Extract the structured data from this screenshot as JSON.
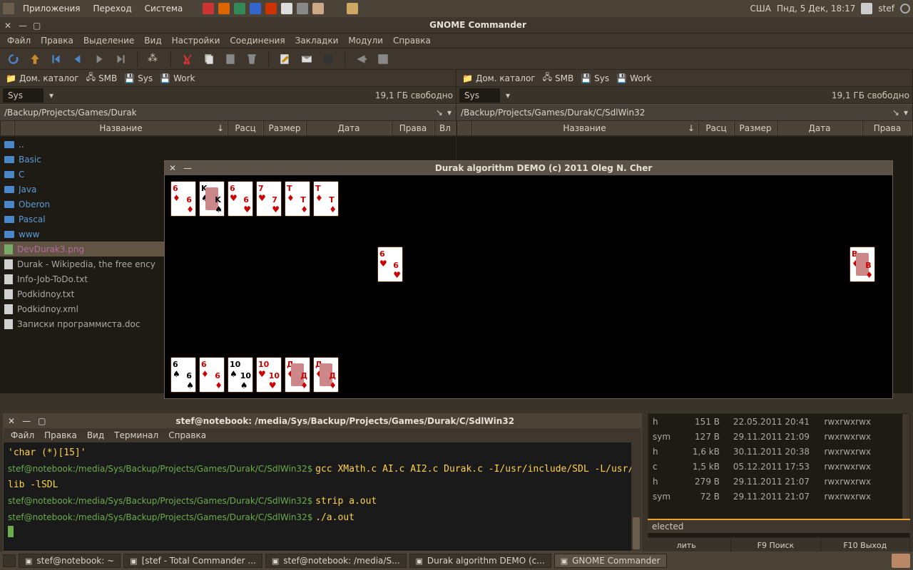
{
  "gnome_panel": {
    "app_menu": "Приложения",
    "places_menu": "Переход",
    "system_menu": "Система",
    "kbd_layout": "США",
    "clock": "Пнд,  5 Дек, 18:17",
    "user": "stef"
  },
  "gcmd": {
    "title": "GNOME Commander",
    "menu": [
      "Файл",
      "Правка",
      "Выделение",
      "Вид",
      "Настройки",
      "Соединения",
      "Закладки",
      "Модули",
      "Справка"
    ],
    "drives": [
      {
        "label": "Дом. каталог",
        "icon": "home-icon"
      },
      {
        "label": "SMB",
        "icon": "smb-icon"
      },
      {
        "label": "Sys",
        "icon": "disk-icon"
      },
      {
        "label": "Work",
        "icon": "disk-icon"
      }
    ],
    "left": {
      "volume": "Sys",
      "free": "19,1 ГБ свободно",
      "path": "/Backup/Projects/Games/Durak",
      "cols": [
        "Название",
        "Расц",
        "Размер",
        "Дата",
        "Права",
        "Вл"
      ],
      "rows": [
        {
          "name": "..",
          "cls": "fn-gray",
          "icon": "fldr"
        },
        {
          "name": "Basic",
          "cls": "fn-blue",
          "icon": "fldr"
        },
        {
          "name": "C",
          "cls": "fn-blue",
          "icon": "fldr"
        },
        {
          "name": "Java",
          "cls": "fn-blue",
          "icon": "fldr"
        },
        {
          "name": "Oberon",
          "cls": "fn-blue",
          "icon": "fldr"
        },
        {
          "name": "Pascal",
          "cls": "fn-blue",
          "icon": "fldr"
        },
        {
          "name": "www",
          "cls": "fn-blue",
          "icon": "fldr"
        },
        {
          "name": "DevDurak3.png",
          "cls": "fn-magenta",
          "icon": "imgi",
          "sel": true
        },
        {
          "name": "Durak - Wikipedia, the free ency",
          "cls": "fn-gray",
          "icon": "filei"
        },
        {
          "name": "Info-Job-ToDo.txt",
          "cls": "fn-gray",
          "icon": "filei"
        },
        {
          "name": "Podkidnoy.txt",
          "cls": "fn-gray",
          "icon": "filei"
        },
        {
          "name": "Podkidnoy.xml",
          "cls": "fn-gray",
          "icon": "filei"
        },
        {
          "name": "Записки программиста.doc",
          "cls": "fn-gray",
          "icon": "filei"
        }
      ]
    },
    "right": {
      "volume": "Sys",
      "free": "19,1 ГБ свободно",
      "path": "/Backup/Projects/Games/Durak/C/SdlWin32",
      "cols": [
        "Название",
        "Расц",
        "Размер",
        "Дата",
        "Права"
      ],
      "visible_rows": [
        {
          "ext": "h",
          "size": "151 B",
          "date": "22.05.2011 20:41",
          "perm": "rwxrwxrwx"
        },
        {
          "ext": "sym",
          "size": "127 B",
          "date": "29.11.2011 21:09",
          "perm": "rwxrwxrwx"
        },
        {
          "ext": "h",
          "size": "1,6 kB",
          "date": "30.11.2011 20:38",
          "perm": "rwxrwxrwx"
        },
        {
          "ext": "c",
          "size": "1,5 kB",
          "date": "05.12.2011 17:53",
          "perm": "rwxrwxrwx"
        },
        {
          "ext": "h",
          "size": "279 B",
          "date": "29.11.2011 21:07",
          "perm": "rwxrwxrwx"
        },
        {
          "ext": "sym",
          "size": "72 B",
          "date": "29.11.2011 21:07",
          "perm": "rwxrwxrwx"
        }
      ],
      "status": "elected"
    },
    "fkeys": [
      "лить",
      "F9 Поиск",
      "F10 Выход"
    ]
  },
  "durak": {
    "title": "Durak algorithm DEMO (c) 2011 Oleg N. Cher",
    "top_hand": [
      {
        "rank": "6",
        "suit": "♦",
        "color": "red"
      },
      {
        "rank": "K",
        "suit": "♠",
        "color": "blk",
        "face": true
      },
      {
        "rank": "6",
        "suit": "♥",
        "color": "red"
      },
      {
        "rank": "7",
        "suit": "♥",
        "color": "red"
      },
      {
        "rank": "T",
        "suit": "♦",
        "color": "red"
      },
      {
        "rank": "T",
        "suit": "♦",
        "color": "red"
      }
    ],
    "table": [
      {
        "rank": "6",
        "suit": "♥",
        "color": "red"
      }
    ],
    "trump": {
      "rank": "B",
      "suit": "♦",
      "color": "red",
      "face": true
    },
    "bottom_hand": [
      {
        "rank": "6",
        "suit": "♠",
        "color": "blk"
      },
      {
        "rank": "6",
        "suit": "♦",
        "color": "red"
      },
      {
        "rank": "10",
        "suit": "♠",
        "color": "blk"
      },
      {
        "rank": "10",
        "suit": "♥",
        "color": "red"
      },
      {
        "rank": "Д",
        "suit": "♦",
        "color": "red",
        "face": true
      },
      {
        "rank": "Д",
        "suit": "♦",
        "color": "red",
        "face": true
      }
    ]
  },
  "terminal": {
    "title": "stef@notebook: /media/Sys/Backup/Projects/Games/Durak/C/SdlWin32",
    "menu": [
      "Файл",
      "Правка",
      "Вид",
      "Терминал",
      "Справка"
    ],
    "lines": [
      {
        "prompt": "",
        "text": "'char (*)[15]'"
      },
      {
        "prompt": "stef@notebook:/media/Sys/Backup/Projects/Games/Durak/C/SdlWin32$ ",
        "text": "gcc XMath.c AI.c AI2.c Durak.c -I/usr/include/SDL -L/usr/lib -lSDL"
      },
      {
        "prompt": "stef@notebook:/media/Sys/Backup/Projects/Games/Durak/C/SdlWin32$ ",
        "text": "strip a.out"
      },
      {
        "prompt": "stef@notebook:/media/Sys/Backup/Projects/Games/Durak/C/SdlWin32$ ",
        "text": "./a.out"
      }
    ]
  },
  "taskbar": {
    "tasks": [
      {
        "label": "stef@notebook: ~"
      },
      {
        "label": "[stef - Total Commander ..."
      },
      {
        "label": "stef@notebook: /media/S..."
      },
      {
        "label": "Durak algorithm DEMO (c..."
      },
      {
        "label": "GNOME Commander"
      }
    ]
  }
}
